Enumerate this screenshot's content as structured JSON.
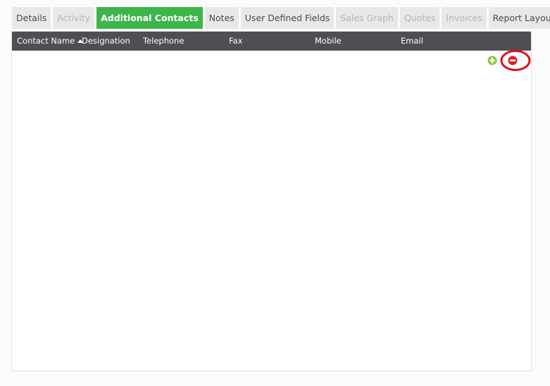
{
  "tabs": [
    {
      "label": "Details",
      "state": "normal"
    },
    {
      "label": "Activity",
      "state": "disabled"
    },
    {
      "label": "Additional Contacts",
      "state": "active"
    },
    {
      "label": "Notes",
      "state": "normal"
    },
    {
      "label": "User Defined Fields",
      "state": "normal"
    },
    {
      "label": "Sales Graph",
      "state": "disabled"
    },
    {
      "label": "Quotes",
      "state": "disabled"
    },
    {
      "label": "Invoices",
      "state": "disabled"
    },
    {
      "label": "Report Layouts",
      "state": "normal"
    }
  ],
  "grid": {
    "columns": {
      "contact_name": "Contact Name",
      "designation": "Designation",
      "telephone": "Telephone",
      "fax": "Fax",
      "mobile": "Mobile",
      "email": "Email"
    },
    "sort": {
      "column": "contact_name",
      "direction": "ascending"
    }
  },
  "icons": {
    "add": "plus-circle-icon",
    "remove": "minus-circle-icon"
  },
  "colors": {
    "active_tab": "#3db54a",
    "header_bg": "#4d4f53",
    "add_icon": "#8cc63f",
    "remove_icon": "#d8232a",
    "annotation": "#e0101a"
  }
}
